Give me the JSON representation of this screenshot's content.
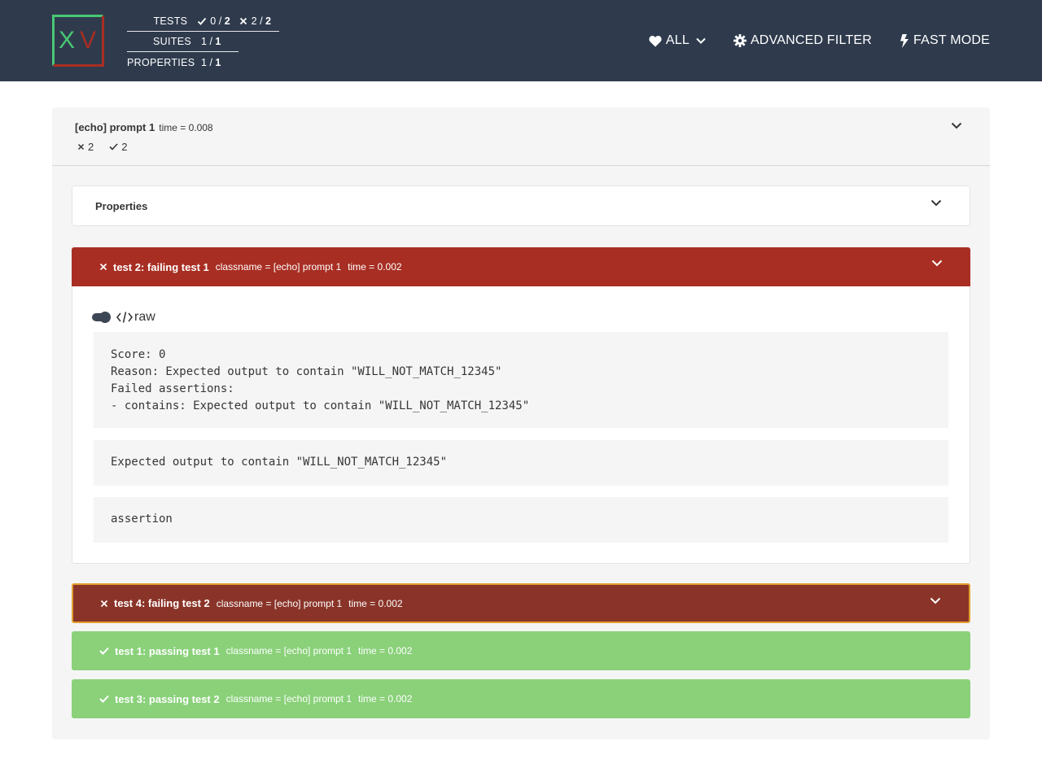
{
  "logo": {
    "letter_left": "X",
    "letter_right": "V"
  },
  "stats": {
    "tests_label": "TESTS",
    "tests_passed": "0",
    "tests_passed_total": "2",
    "tests_failed": "2",
    "tests_failed_total": "2",
    "sep": "/",
    "suites_label": "SUITES",
    "suites_value": "1",
    "suites_total": "1",
    "properties_label": "PROPERTIES",
    "properties_value": "1",
    "properties_total": "1"
  },
  "nav": {
    "filter_label": "ALL",
    "advanced_filter_label": "ADVANCED FILTER",
    "fast_mode_label": "FAST MODE"
  },
  "suite": {
    "name": "[echo] prompt 1",
    "time": "time = 0.008",
    "failed_count": "2",
    "passed_count": "2",
    "properties_label": "Properties"
  },
  "cases": [
    {
      "name": "test 2: failing test 1",
      "classname": "classname = [echo] prompt 1",
      "time": "time = 0.002",
      "status": "failed",
      "raw_label": "raw",
      "output": "Score: 0\nReason: Expected output to contain \"WILL_NOT_MATCH_12345\"\nFailed assertions:\n- contains: Expected output to contain \"WILL_NOT_MATCH_12345\"",
      "message": "Expected output to contain \"WILL_NOT_MATCH_12345\"",
      "type": "assertion"
    },
    {
      "name": "test 4: failing test 2",
      "classname": "classname = [echo] prompt 1",
      "time": "time = 0.002",
      "status": "failed"
    },
    {
      "name": "test 1: passing test 1",
      "classname": "classname = [echo] prompt 1",
      "time": "time = 0.002",
      "status": "passed"
    },
    {
      "name": "test 3: passing test 2",
      "classname": "classname = [echo] prompt 1",
      "time": "time = 0.002",
      "status": "passed"
    }
  ],
  "colors": {
    "navbar": "#2f3b4d",
    "failed": "#a82e23",
    "failed_selected": "#8a3429",
    "passed": "#8ad17a",
    "logo_x": "#48c774",
    "logo_v": "#a82e23"
  }
}
